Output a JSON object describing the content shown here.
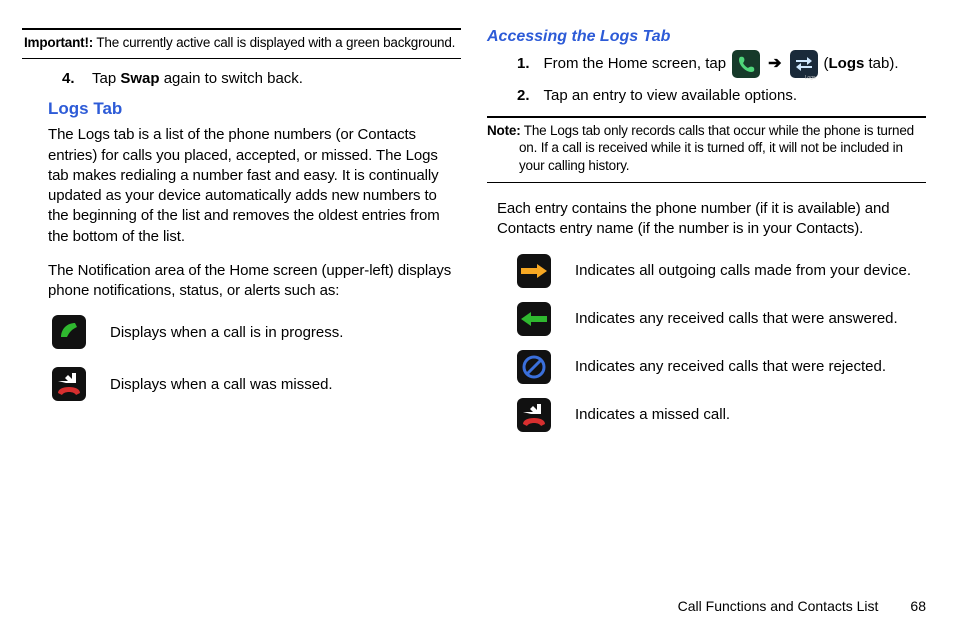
{
  "left": {
    "important": {
      "lead": "Important!:",
      "text": " The currently active call is displayed with a green background."
    },
    "step4": {
      "num": "4.",
      "pre": "Tap ",
      "bold": "Swap",
      "post": " again to switch back."
    },
    "h2": "Logs Tab",
    "p1": "The Logs tab is a list of the phone numbers (or Contacts entries) for calls you placed, accepted, or missed. The Logs tab makes redialing a number fast and easy. It is continually updated as your device automatically adds new numbers to the beginning of the list and removes the oldest entries from the bottom of the list.",
    "p2": "The Notification area of the Home screen (upper-left) displays phone notifications, status, or alerts such as:",
    "iconA": {
      "name": "call-in-progress-icon",
      "desc": "Displays when a call is in progress."
    },
    "iconB": {
      "name": "missed-call-icon",
      "desc": "Displays when a call was missed."
    }
  },
  "right": {
    "h3": "Accessing the Logs Tab",
    "step1": {
      "num": "1.",
      "pre": "From the Home screen, tap",
      "arrow": "➔",
      "open_paren": "(",
      "bold": "Logs",
      "post": " tab)."
    },
    "logs_icon_label": "Logs",
    "step2": {
      "num": "2.",
      "text": "Tap an entry to view available options."
    },
    "note": {
      "lead": "Note:",
      "text": " The Logs tab only records calls that occur while the phone is turned on. If a call is received while it is turned off, it will not be included in your calling history."
    },
    "p3": "Each entry contains the phone number (if it is available) and Contacts entry name (if the number is in your Contacts).",
    "icons": [
      {
        "name": "outgoing-call-icon",
        "desc": "Indicates all outgoing calls made from your device."
      },
      {
        "name": "received-call-icon",
        "desc": "Indicates any received calls that were answered."
      },
      {
        "name": "rejected-call-icon",
        "desc": "Indicates any received calls that were rejected."
      },
      {
        "name": "missed-call-log-icon",
        "desc": "Indicates a missed call."
      }
    ]
  },
  "footer": {
    "section": "Call Functions and Contacts List",
    "page": "68"
  }
}
